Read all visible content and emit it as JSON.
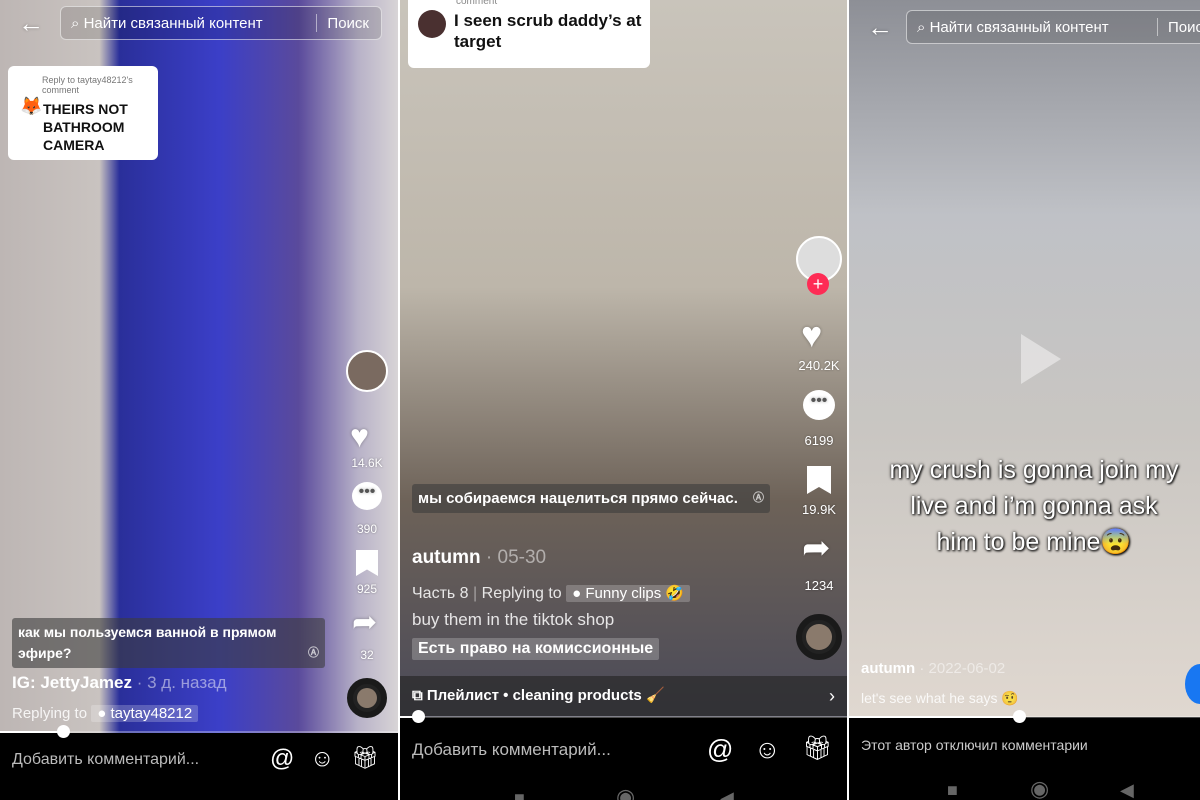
{
  "panel1": {
    "search": {
      "placeholder": "Найти связанный контент",
      "button": "Поиск"
    },
    "reply_bubble": {
      "header": "Reply to taytay48212's comment",
      "text": "THEIRS NOT BATHROOM CAMERA"
    },
    "counts": {
      "likes": "14.6K",
      "comments": "390",
      "saves": "925",
      "shares": "32"
    },
    "caption": "как мы пользуемся ванной в прямом эфире?",
    "author": "IG: JettyJamez",
    "date": "· 3 д. назад",
    "replying_label": "Replying to",
    "replying_user": "taytay48212",
    "progress": 0.16,
    "comment_placeholder": "Добавить комментарий..."
  },
  "panel2": {
    "reply_bubble": {
      "header": "comment",
      "text": "I seen scrub daddy’s at target"
    },
    "counts": {
      "likes": "240.2K",
      "comments": "6199",
      "saves": "19.9K",
      "shares": "1234"
    },
    "caption": "мы собираемся нацелиться прямо сейчас.",
    "author": "autumn",
    "date": "· 05-30",
    "part": "Часть 8",
    "replying_label": "Replying to",
    "replying_user": "Funny clips 🤣",
    "description": "buy them in the tiktok shop",
    "commission": "Есть право на комиссионные",
    "playlist": "Плейлист • cleaning products 🧹",
    "progress": 0.04,
    "comment_placeholder": "Добавить комментарий..."
  },
  "panel3": {
    "search": {
      "placeholder": "Найти связанный контент",
      "button": "Поис"
    },
    "overlay_text": [
      "my crush is gonna join my",
      "live and i’m gonna ask",
      "him to be mine😨"
    ],
    "author": "autumn",
    "date": "· 2022-06-02",
    "description": "let's see what he says 🤨",
    "progress": 0.48,
    "comments_disabled": "Этот автор отключил комментарии"
  },
  "colors": {
    "accent": "#fe2c55",
    "background": "#000000"
  }
}
